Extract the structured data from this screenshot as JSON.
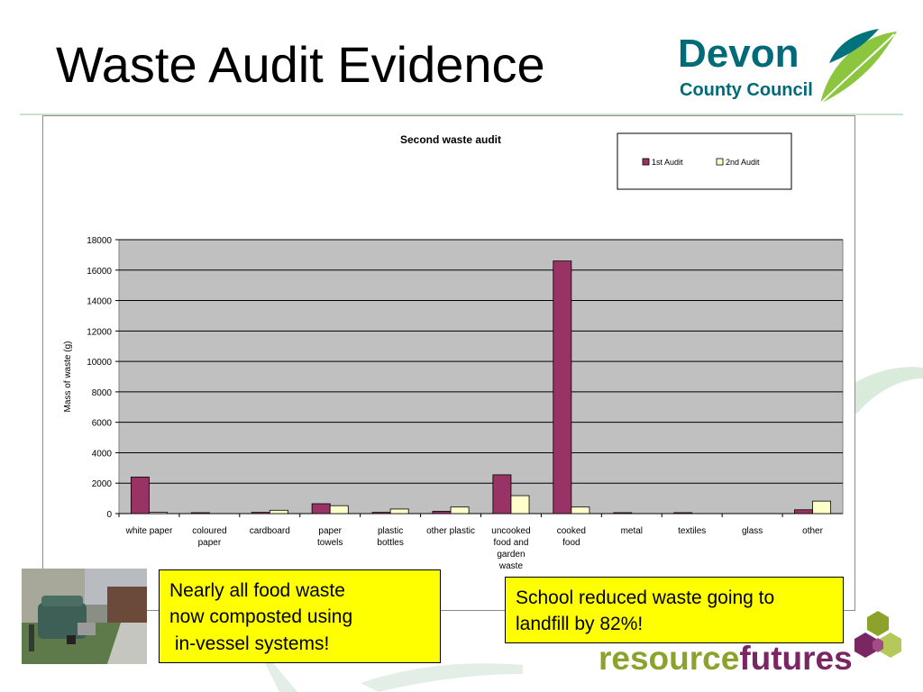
{
  "slide": {
    "title": "Waste Audit Evidence"
  },
  "logo_devon": {
    "line1": "Devon",
    "line2": "County Council"
  },
  "logo_resource": {
    "part1": "resource",
    "part2": "futures"
  },
  "callouts": {
    "left": "Nearly all food waste\nnow composted using\n in-vessel systems!",
    "right": "School reduced waste going to\nlandfill by 82%!"
  },
  "chart_data": {
    "type": "bar",
    "title": "Second waste audit",
    "xlabel": "",
    "ylabel": "Mass of waste  (g)",
    "ylim": [
      0,
      18000
    ],
    "yticks": [
      0,
      2000,
      4000,
      6000,
      8000,
      10000,
      12000,
      14000,
      16000,
      18000
    ],
    "grid": true,
    "legend_position": "top-right",
    "categories": [
      [
        "white paper"
      ],
      [
        "coloured",
        "paper"
      ],
      [
        "cardboard"
      ],
      [
        "paper",
        "towels"
      ],
      [
        "plastic",
        "bottles"
      ],
      [
        "other plastic"
      ],
      [
        "uncooked",
        "food and",
        "garden",
        "waste"
      ],
      [
        "cooked",
        "food"
      ],
      [
        "metal"
      ],
      [
        "textiles"
      ],
      [
        "glass"
      ],
      [
        "other"
      ]
    ],
    "series": [
      {
        "name": "1st Audit",
        "color": "#993366",
        "values": [
          2400,
          60,
          80,
          650,
          80,
          150,
          2550,
          16600,
          60,
          60,
          0,
          250
        ]
      },
      {
        "name": "2nd Audit",
        "color": "#ffffcc",
        "values": [
          80,
          0,
          220,
          520,
          300,
          430,
          1180,
          430,
          0,
          0,
          0,
          820
        ]
      }
    ],
    "plot_background": "#c0c0c0"
  }
}
